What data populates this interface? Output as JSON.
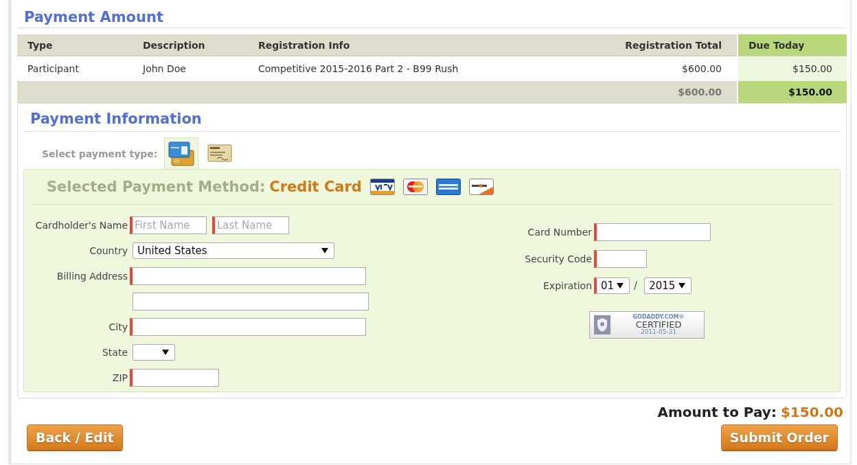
{
  "payment_amount": {
    "title": "Payment Amount",
    "table": {
      "columns": [
        "Type",
        "Description",
        "Registration Info",
        "Registration Total",
        "Due Today"
      ],
      "rows": [
        [
          "Participant",
          "John Doe",
          "Competitive 2015-2016 Part 2 - B99 Rush",
          "$600.00",
          "$150.00"
        ]
      ],
      "totals": {
        "registration_total": "$600.00",
        "due_today": "$150.00"
      }
    }
  },
  "payment_information": {
    "title": "Payment Information",
    "select_label": "Select payment type:",
    "payment_types": [
      {
        "kind": "card",
        "selected": true
      },
      {
        "kind": "check",
        "selected": false
      }
    ],
    "method_label": "Selected Payment Method:",
    "method_value": "Credit Card",
    "card_logos": [
      {
        "kind": "visa"
      },
      {
        "kind": "mastercard"
      },
      {
        "kind": "amex"
      },
      {
        "kind": "discover"
      }
    ],
    "left_fields": [
      {
        "label": "Cardholder's Name",
        "kind": "name",
        "required": true,
        "placeholders": [
          "First Name",
          "Last Name"
        ]
      },
      {
        "label": "Country",
        "kind": "select-wide",
        "required": false,
        "value": "United States"
      },
      {
        "label": "Billing Address",
        "kind": "text-wide",
        "required": true
      },
      {
        "kind": "text-wide",
        "required": false
      },
      {
        "label": "City",
        "kind": "text-wide",
        "required": true
      },
      {
        "label": "State",
        "kind": "select-small",
        "required": false
      },
      {
        "label": "ZIP",
        "kind": "text-short",
        "required": true
      }
    ],
    "right_fields": [
      {
        "label": "Card Number",
        "kind": "text-medium",
        "required": true
      },
      {
        "label": "Security Code",
        "kind": "text-small",
        "required": true
      },
      {
        "label": "Expiration",
        "kind": "expiry",
        "required": true,
        "month": "01",
        "separator": "/",
        "year": "2015"
      }
    ],
    "seal": {
      "brand": "GODADDY.COM®",
      "status": "CERTIFIED",
      "date": "2011-05-31"
    }
  },
  "amount_to_pay": {
    "label": "Amount to Pay:",
    "value": "$150.00"
  },
  "buttons": [
    {
      "label": "Back / Edit",
      "kind": "back"
    },
    {
      "label": "Submit Order",
      "kind": "submit"
    }
  ]
}
